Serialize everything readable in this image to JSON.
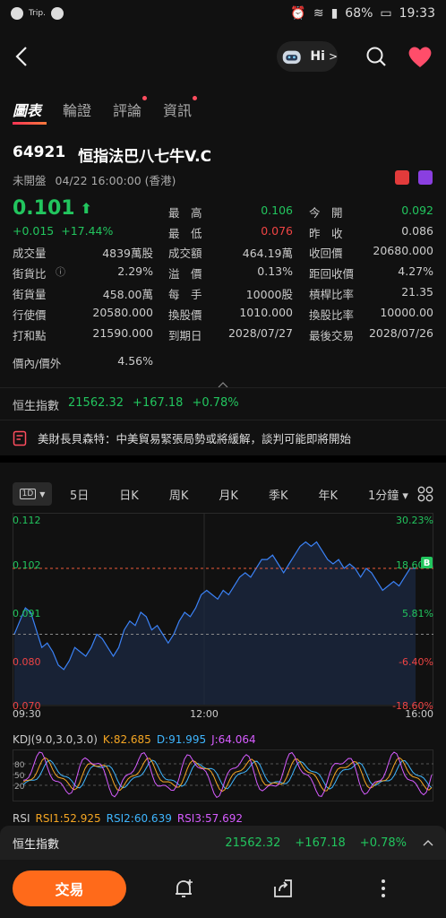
{
  "status_bar": {
    "left_label": "Trip.",
    "battery": "68%",
    "time": "19:33"
  },
  "nav": {
    "hi_label": "Hi",
    "hi_chevron": ">"
  },
  "tabs": [
    {
      "label": "圖表",
      "active": true,
      "dot": false
    },
    {
      "label": "輪證",
      "active": false,
      "dot": false
    },
    {
      "label": "評論",
      "active": false,
      "dot": true
    },
    {
      "label": "資訊",
      "active": false,
      "dot": true
    }
  ],
  "security": {
    "code": "64921",
    "name": "恒指法巴八七牛V.C",
    "market_status": "未開盤",
    "datetime": "04/22 16:00:00 (香港)"
  },
  "quote": {
    "price": "0.101",
    "change": "+0.015",
    "change_pct": "+17.44%"
  },
  "stats": {
    "high_label": "最　高",
    "high": "0.106",
    "open_label": "今　開",
    "open": "0.092",
    "low_label": "最　低",
    "low": "0.076",
    "prev_label": "昨　收",
    "prev": "0.086",
    "volume_label": "成交量",
    "volume": "4839萬股",
    "turnover_label": "成交額",
    "turnover": "464.19萬",
    "call_price_label": "收回價",
    "call_price": "20680.000",
    "street_ratio_label": "街貨比",
    "street_ratio": "2.29%",
    "premium_label": "溢　價",
    "premium": "0.13%",
    "dist_call_label": "距回收價",
    "dist_call": "4.27%",
    "street_qty_label": "街貨量",
    "street_qty": "458.00萬",
    "lot_label": "每　手",
    "lot": "10000股",
    "leverage_label": "槓桿比率",
    "leverage": "21.35",
    "strike_label": "行使價",
    "strike": "20580.000",
    "conv_price_label": "換股價",
    "conv_price": "1010.000",
    "conv_ratio_label": "換股比率",
    "conv_ratio": "10000.00",
    "breakeven_label": "打和點",
    "breakeven": "21590.000",
    "expiry_label": "到期日",
    "expiry": "2028/07/27",
    "last_trade_label": "最後交易",
    "last_trade": "2028/07/26",
    "moneyness_label": "價內/價外",
    "moneyness": "4.56%"
  },
  "hsi": {
    "name": "恒生指數",
    "value": "21562.32",
    "change": "+167.18",
    "change_pct": "+0.78%"
  },
  "news": {
    "text": "美財長貝森特：中美貿易緊張局勢或將緩解，談判可能即將開始"
  },
  "periods": {
    "selected": "1D",
    "items": [
      "5日",
      "日K",
      "周K",
      "月K",
      "季K",
      "年K",
      "1分鐘 ▾"
    ]
  },
  "chart_data": {
    "type": "line",
    "y_labels_left": [
      "0.112",
      "0.102",
      "0.091",
      "0.080",
      "0.070"
    ],
    "y_labels_right": [
      "30.23%",
      "18.60%",
      "5.81%",
      "-6.40%",
      "-18.60%"
    ],
    "x_labels": [
      "09:30",
      "12:00",
      "16:00"
    ],
    "ylim": [
      0.07,
      0.112
    ],
    "current": 0.101,
    "prev_close": 0.086,
    "values": [
      0.086,
      0.089,
      0.092,
      0.091,
      0.087,
      0.083,
      0.084,
      0.082,
      0.079,
      0.078,
      0.08,
      0.083,
      0.082,
      0.081,
      0.083,
      0.086,
      0.085,
      0.083,
      0.081,
      0.083,
      0.087,
      0.089,
      0.088,
      0.091,
      0.09,
      0.087,
      0.088,
      0.086,
      0.084,
      0.086,
      0.089,
      0.091,
      0.09,
      0.092,
      0.095,
      0.096,
      0.095,
      0.094,
      0.096,
      0.095,
      0.097,
      0.099,
      0.1,
      0.099,
      0.101,
      0.103,
      0.103,
      0.104,
      0.102,
      0.1,
      0.102,
      0.104,
      0.106,
      0.107,
      0.106,
      0.107,
      0.105,
      0.103,
      0.102,
      0.103,
      0.101,
      0.102,
      0.101,
      0.099,
      0.101,
      0.1,
      0.098,
      0.096,
      0.097,
      0.098,
      0.097,
      0.099,
      0.101,
      0.101
    ],
    "marker_label": "B"
  },
  "kdj": {
    "label": "KDJ(9.0,3.0,3.0)",
    "k": "K:82.685",
    "d": "D:91.995",
    "j": "J:64.064",
    "levels": [
      "80",
      "50",
      "20"
    ]
  },
  "rsi": {
    "label": "RSI",
    "rsi1": "RSI1:52.925",
    "rsi2": "RSI2:60.639",
    "rsi3": "RSI3:57.692"
  },
  "bottom_bar": {
    "trade_label": "交易"
  },
  "colors": {
    "up": "#22c55e",
    "down": "#ef4444",
    "accent": "#ff6a1a",
    "line": "#3b82f6"
  }
}
